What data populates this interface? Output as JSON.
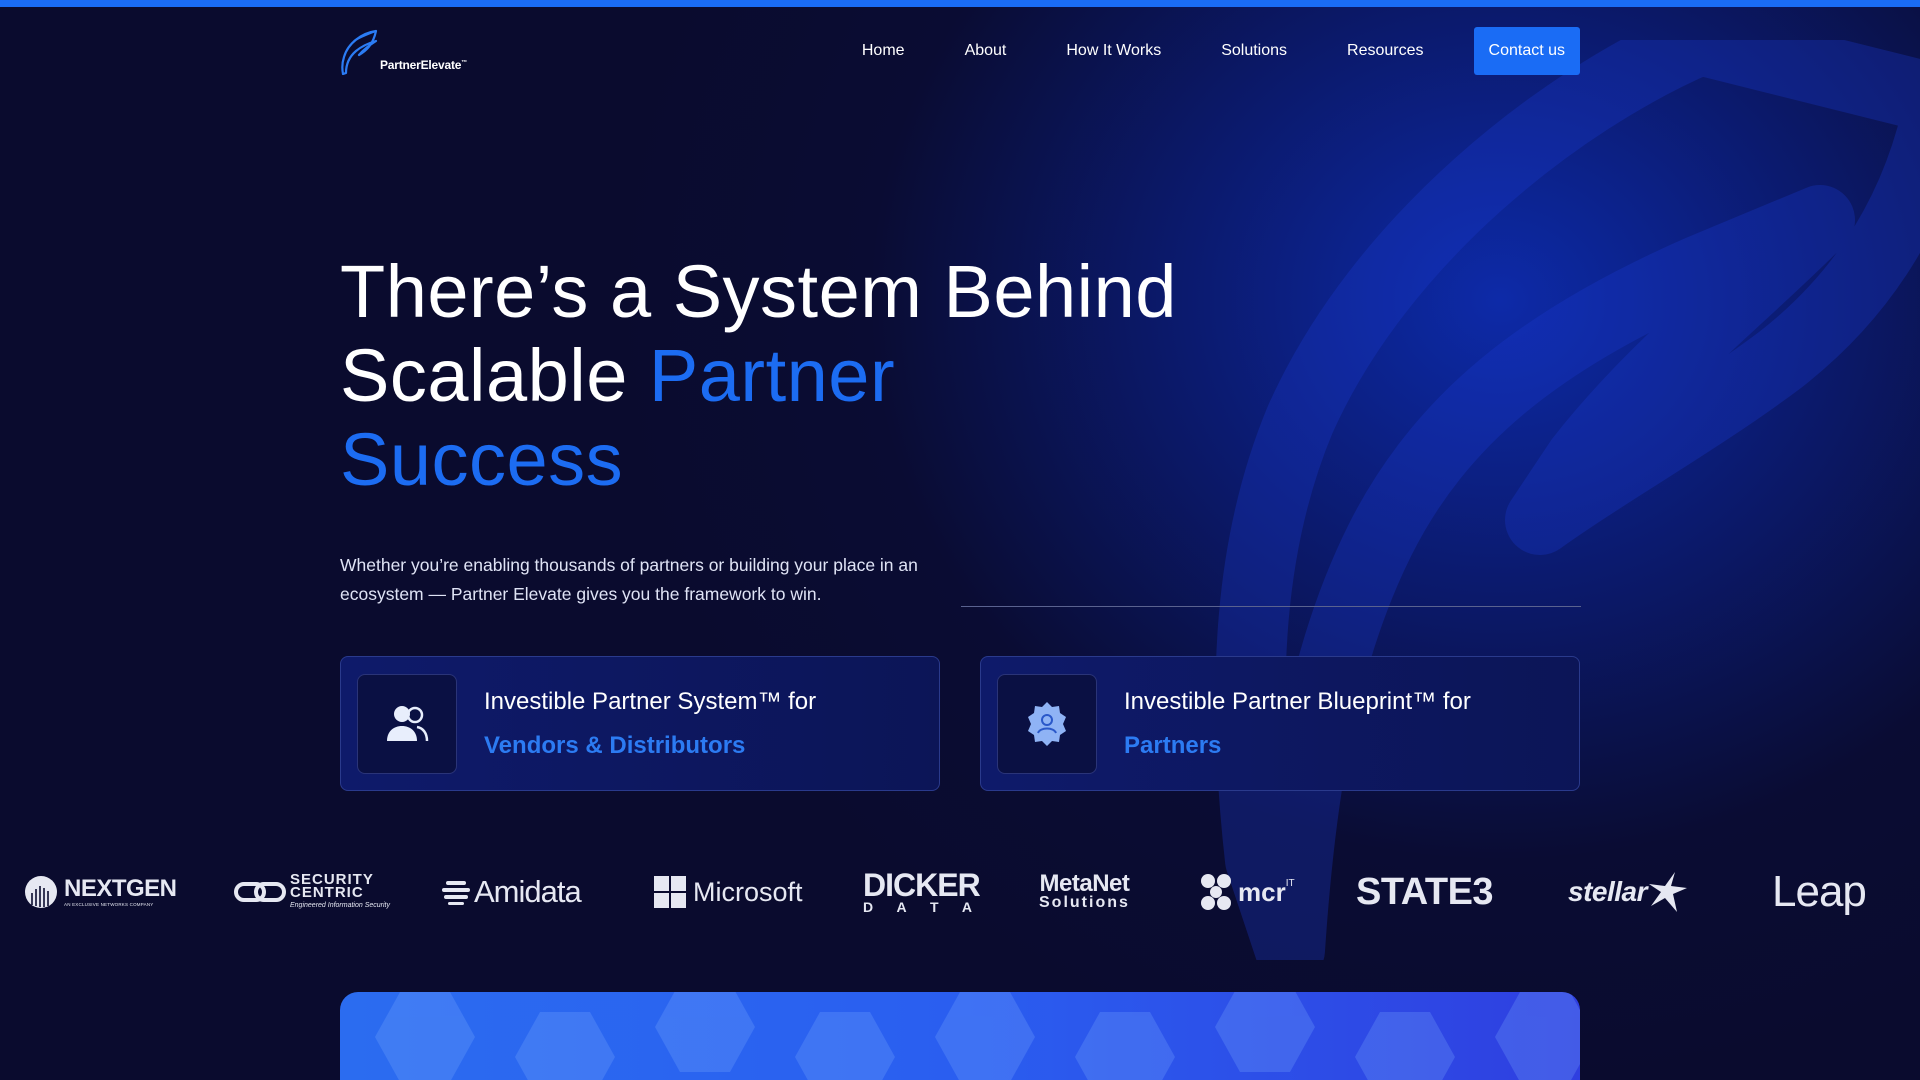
{
  "brand": {
    "name": "PartnerElevate",
    "tm": "™"
  },
  "nav": {
    "items": [
      "Home",
      "About",
      "How It Works",
      "Solutions",
      "Resources"
    ],
    "cta": "Contact us"
  },
  "hero": {
    "title_line1": "There’s a System Behind",
    "title_line2_plain": "Scalable ",
    "title_line2_accent": "Partner",
    "title_line3_accent": "Success",
    "subtitle": "Whether you’re enabling thousands of partners or building your place in an ecosystem — Partner Elevate gives you the framework to win."
  },
  "cards": [
    {
      "line1": "Investible Partner System™ for",
      "line2": "Vendors & Distributors",
      "icon": "users-icon"
    },
    {
      "line1": "Investible Partner Blueprint™ for",
      "line2": "Partners",
      "icon": "badge-user-icon"
    }
  ],
  "logos": {
    "nextgen": "NEXTGEN",
    "nextgen_sub": "AN EXCLUSIVE NETWORKS COMPANY",
    "security_1": "SECURITY",
    "security_2": "CENTRIC",
    "security_sub": "Engineered Information Security",
    "amidata": "Amidata",
    "microsoft": "Microsoft",
    "dicker_1": "DICKER",
    "dicker_2": "D A T A",
    "metanet_1": "MetaNet",
    "metanet_2": "Solutions",
    "mcr": "mcr",
    "mcr_sup": "IT",
    "state3": "STATE3",
    "stellar": "stellar",
    "leap": "Leap"
  },
  "colors": {
    "accent": "#1a6cf5",
    "background": "#0a0b2e",
    "card_accent_text": "#2c7bf2"
  }
}
